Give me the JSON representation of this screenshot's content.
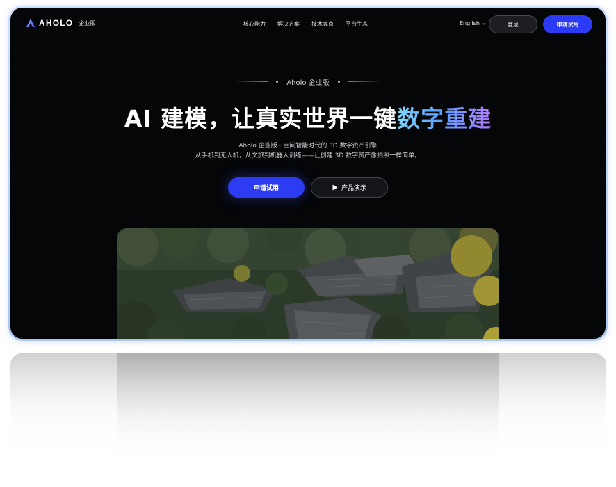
{
  "brand": {
    "name": "AHOLO",
    "edition_tag": "企业版"
  },
  "nav": {
    "links": [
      "核心能力",
      "解决方案",
      "技术亮点",
      "平台生态"
    ],
    "language": "English",
    "login_label": "登录",
    "trial_label": "申请试用"
  },
  "hero": {
    "eyebrow": "Aholo 企业版",
    "headline_plain": "AI 建模，让真实世界一键",
    "headline_gradient": "数字重建",
    "subtitle_line1": "Aholo 企业版 · 空间智能时代的 3D 数字资产引擎",
    "subtitle_line2": "从手机到无人机，从文旅到机器人训练——让创建 3D 数字资产像拍照一样简单。",
    "primary_cta": "申请试用",
    "demo_cta": "产品演示"
  },
  "colors": {
    "accent": "#2b3bf5",
    "background": "#050608",
    "headline_gradient": [
      "#7fd8ff",
      "#5aa0ff",
      "#b07bff"
    ]
  },
  "icons": {
    "logo": "aholo-logo-icon",
    "language_chevron": "chevron-down-icon",
    "demo_play": "play-icon"
  }
}
